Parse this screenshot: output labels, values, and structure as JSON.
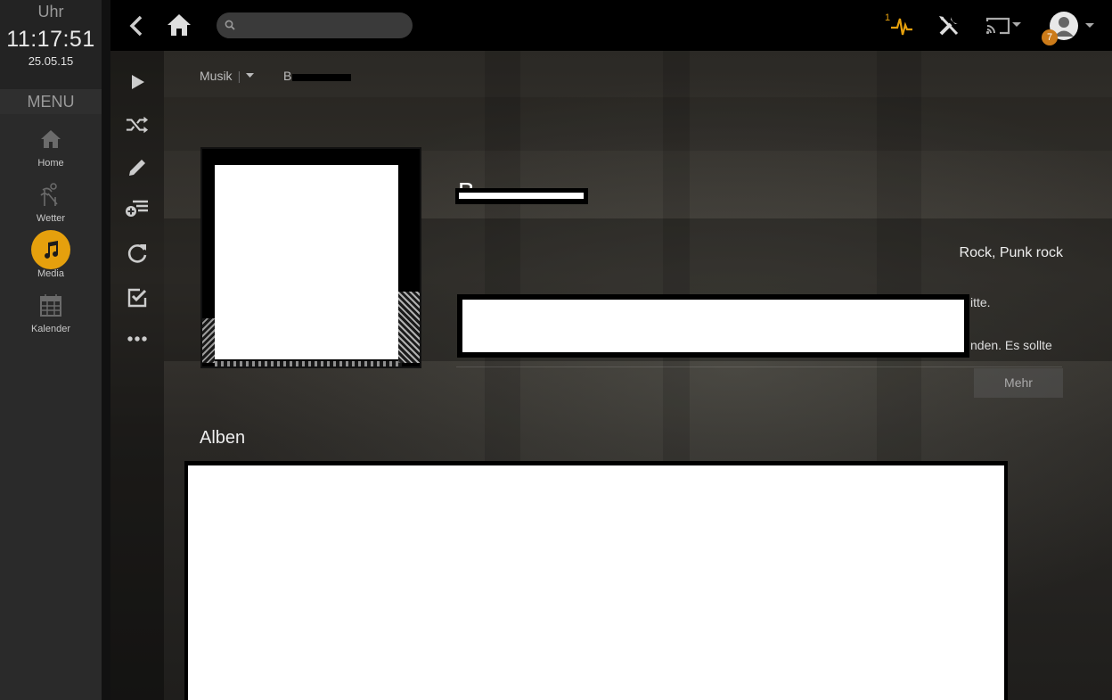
{
  "clock": {
    "label": "Uhr",
    "time": "11:17:51",
    "date": "25.05.15"
  },
  "menu": {
    "title": "MENU",
    "items": [
      {
        "label": "Home",
        "icon": "home-icon"
      },
      {
        "label": "Wetter",
        "icon": "weather-icon"
      },
      {
        "label": "Media",
        "icon": "music-note-icon",
        "active": true
      },
      {
        "label": "Kalender",
        "icon": "calendar-icon"
      }
    ]
  },
  "topbar": {
    "search_placeholder": "",
    "activity_count": "1",
    "notification_count": "7",
    "accent_color": "#e5a00d"
  },
  "side_toolbar": [
    "play-icon",
    "shuffle-icon",
    "edit-icon",
    "add-to-playlist-icon",
    "refresh-icon",
    "mark-watched-icon",
    "more-icon"
  ],
  "breadcrumb": {
    "section": "Musik",
    "current": "B"
  },
  "artist": {
    "title": "B",
    "genre": "Rock, Punk rock",
    "summary_line_1": "itte.",
    "summary_line_2": "nden. Es sollte",
    "more_label": "Mehr"
  },
  "albums": {
    "heading": "Alben"
  }
}
